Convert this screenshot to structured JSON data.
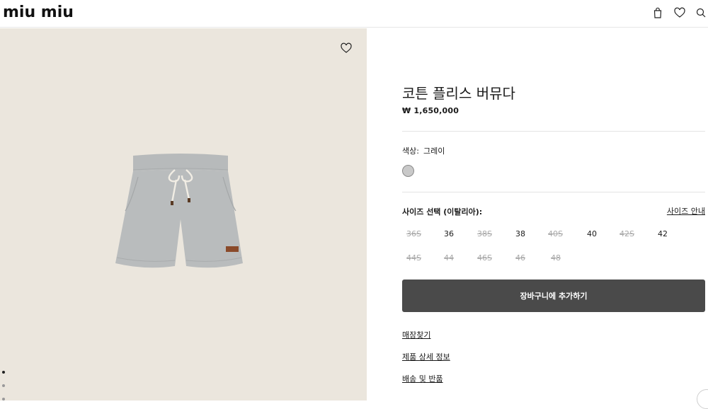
{
  "header": {
    "brand": "miu miu",
    "icons": [
      "bag-icon",
      "heart-icon",
      "search-icon"
    ]
  },
  "gallery": {
    "wishlist_icon": "heart-icon",
    "slide_count": 3,
    "active_slide": 1
  },
  "product": {
    "title": "코튼 플리스 버뮤다",
    "price": "₩ 1,650,000",
    "color_label": "색상:",
    "color_value": "그레이",
    "swatch_color": "#c9c9c9",
    "size_label": "사이즈 선택 (이탈리아):",
    "size_guide": "사이즈 안내",
    "sizes": [
      {
        "label": "36S",
        "available": false
      },
      {
        "label": "36",
        "available": true
      },
      {
        "label": "38S",
        "available": false
      },
      {
        "label": "38",
        "available": true
      },
      {
        "label": "40S",
        "available": false
      },
      {
        "label": "40",
        "available": true
      },
      {
        "label": "42S",
        "available": false
      },
      {
        "label": "42",
        "available": true
      },
      {
        "label": "44S",
        "available": false
      },
      {
        "label": "44",
        "available": false
      },
      {
        "label": "46S",
        "available": false
      },
      {
        "label": "46",
        "available": false
      },
      {
        "label": "48",
        "available": false
      }
    ],
    "add_to_cart": "장바구니에 추가하기",
    "links": {
      "store_finder": "매장찾기",
      "details": "제품 상세 정보",
      "shipping": "배송 및 반품"
    }
  },
  "colors": {
    "image_bg": "#ebe6dd",
    "button_bg": "#4a4a4a",
    "shorts": "#b9bcbd"
  }
}
